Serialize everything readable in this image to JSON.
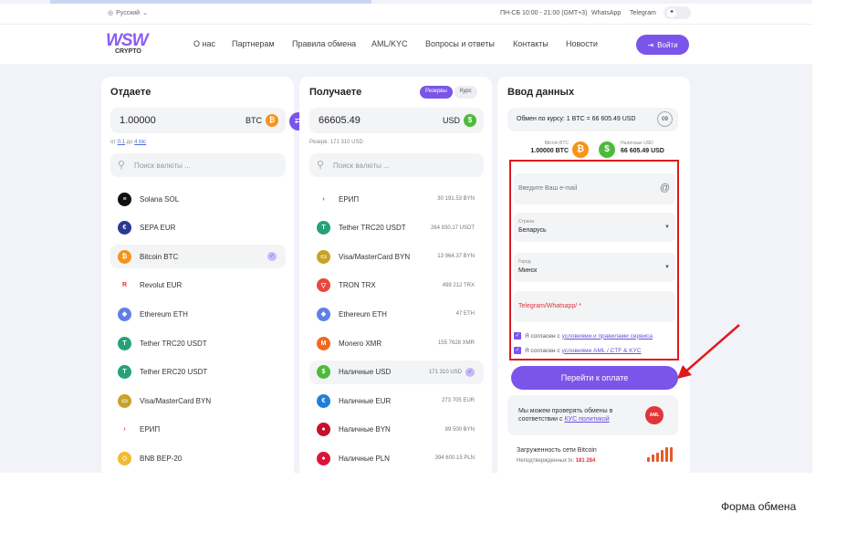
{
  "topbar": {
    "language": "Русский",
    "hours": "ПН-СБ 10:00 - 21:00 (GMT+3)",
    "whatsapp": "WhatsApp",
    "telegram": "Telegram"
  },
  "nav": {
    "logo": "WSW",
    "logo_sub": "CRYPTO",
    "items": [
      "О нас",
      "Партнерам",
      "Правила обмена",
      "AML/KYC",
      "Вопросы и ответы",
      "Контакты",
      "Новости"
    ],
    "login": "Войти"
  },
  "give": {
    "title": "Отдаете",
    "amount": "1.00000",
    "currency": "BTC",
    "hint_from": "от",
    "hint_min": "0.1",
    "hint_to": "до",
    "hint_max": "4 btc",
    "search_placeholder": "Поиск валюты ...",
    "items": [
      {
        "name": "Solana SOL",
        "color": "#111111",
        "glyph": "≡"
      },
      {
        "name": "SEPA EUR",
        "color": "#2b3a8f",
        "glyph": "€"
      },
      {
        "name": "Bitcoin BTC",
        "color": "#f7931a",
        "glyph": "₿",
        "selected": true
      },
      {
        "name": "Revolut EUR",
        "color": "#ffffff",
        "glyph": "R"
      },
      {
        "name": "Ethereum ETH",
        "color": "#627eea",
        "glyph": "◆"
      },
      {
        "name": "Tether TRC20 USDT",
        "color": "#26a17b",
        "glyph": "T"
      },
      {
        "name": "Tether ERC20 USDT",
        "color": "#26a17b",
        "glyph": "T"
      },
      {
        "name": "Visa/MasterCard BYN",
        "color": "#c9a227",
        "glyph": "▭"
      },
      {
        "name": "ЕРИП",
        "color": "#ffffff",
        "glyph": "›"
      },
      {
        "name": "BNB BEP-20",
        "color": "#f3ba2f",
        "glyph": "◇"
      }
    ]
  },
  "receive": {
    "title": "Получаете",
    "tab_reserves": "Резервы",
    "tab_rate": "Курс",
    "amount": "66605.49",
    "currency": "USD",
    "reserve": "Резерв: 171 310 USD",
    "search_placeholder": "Поиск валюты ...",
    "items": [
      {
        "name": "ЕРИП",
        "reserve": "30 191.53 BYN",
        "color": "#ffffff",
        "glyph": "›"
      },
      {
        "name": "Tether TRC20 USDT",
        "reserve": "264 930.17 USDT",
        "color": "#26a17b",
        "glyph": "T"
      },
      {
        "name": "Visa/MasterCard BYN",
        "reserve": "13 964.37 BYN",
        "color": "#c9a227",
        "glyph": "▭"
      },
      {
        "name": "TRON TRX",
        "reserve": "499 212 TRX",
        "color": "#e8483b",
        "glyph": "▽"
      },
      {
        "name": "Ethereum ETH",
        "reserve": "47 ETH",
        "color": "#627eea",
        "glyph": "◆"
      },
      {
        "name": "Monero XMR",
        "reserve": "155 7628 XMR",
        "color": "#f26822",
        "glyph": "M"
      },
      {
        "name": "Наличные USD",
        "reserve": "171 310 USD",
        "color": "#4cbb3a",
        "glyph": "$",
        "selected": true
      },
      {
        "name": "Наличные EUR",
        "reserve": "273 705 EUR",
        "color": "#1f7fd8",
        "glyph": "€"
      },
      {
        "name": "Наличные BYN",
        "reserve": "89 500 BYN",
        "color": "#c8102e",
        "glyph": "●"
      },
      {
        "name": "Наличные PLN",
        "reserve": "394 600.15 PLN",
        "color": "#dc143c",
        "glyph": "●"
      }
    ]
  },
  "form": {
    "title": "Ввод данных",
    "rate": "Обмен по курсу: 1 BTC = 66 605.49 USD",
    "timer": "09",
    "give_label": "Bitcoin BTC",
    "give_value": "1.00000 BTC",
    "get_label": "Наличные USD",
    "get_value": "66 605.49 USD",
    "email_placeholder": "Введите Ваш e-mail",
    "country_label": "Страна",
    "country_value": "Беларусь",
    "city_label": "Город",
    "city_value": "Минск",
    "telegram_placeholder": "Telegram/Whatsapp/ *",
    "agree1_text": "Я согласен с",
    "agree1_link": "условиями и правилами сервиса",
    "agree2_text": "Я согласен с",
    "agree2_link": "условиями AML / CTF & KYC",
    "pay": "Перейти к оплате",
    "aml_text": "Мы можем проверять обмены в соответствии с",
    "aml_link": "КУС политикой",
    "aml_badge": "AML",
    "load_title": "Загруженность сети Bitcoin",
    "load_label": "Неподтвержденных tx:",
    "load_value": "181 284"
  },
  "caption": "Форма обмена",
  "colors": {
    "accent": "#7b55e9",
    "highlight": "#e0191c"
  }
}
